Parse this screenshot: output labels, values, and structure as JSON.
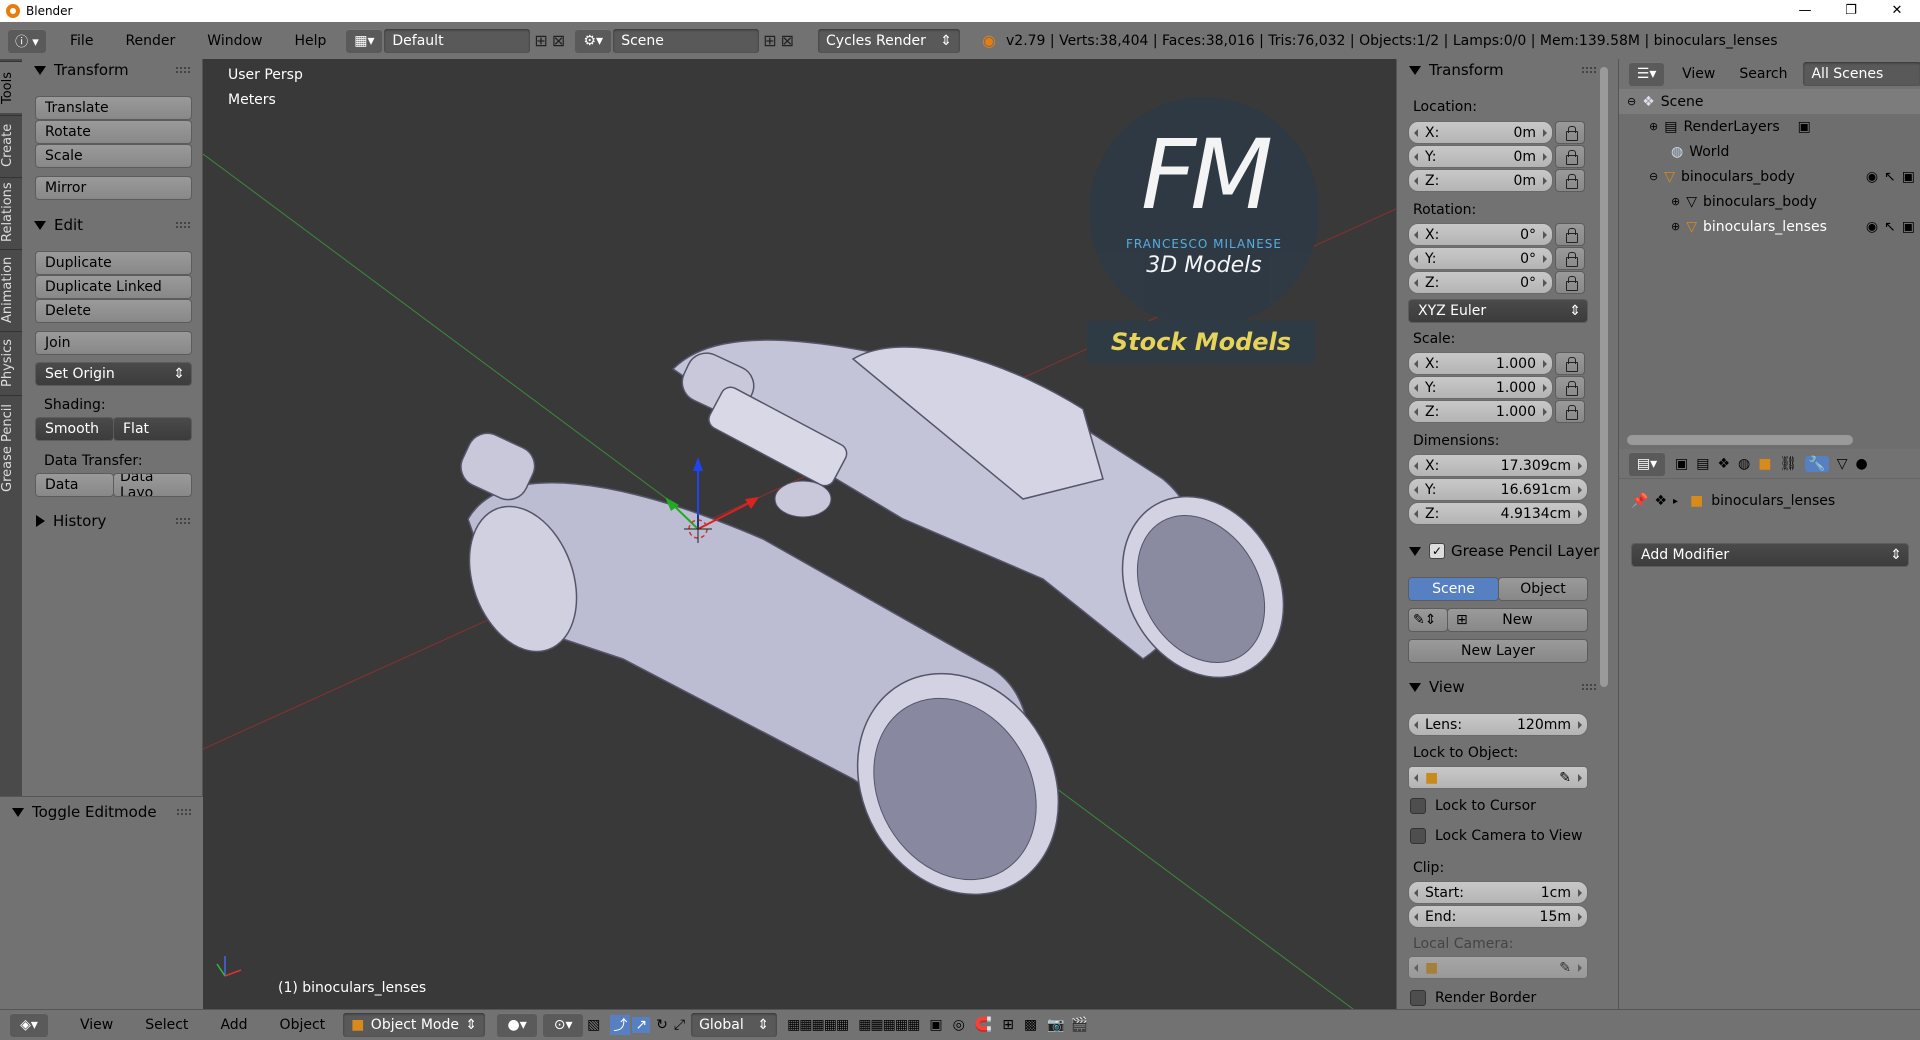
{
  "titlebar": {
    "title": "Blender",
    "min": "—",
    "max": "❐",
    "close": "✕"
  },
  "infobar": {
    "menus": [
      "File",
      "Render",
      "Window",
      "Help"
    ],
    "screen": "Default",
    "scene": "Scene",
    "engine": "Cycles Render",
    "stats": "v2.79 | Verts:38,404 | Faces:38,016 | Tris:76,032 | Objects:1/2 | Lamps:0/0 | Mem:139.58M | binoculars_lenses"
  },
  "tooltabs": [
    "Tools",
    "Create",
    "Relations",
    "Animation",
    "Physics",
    "Grease Pencil"
  ],
  "tools": {
    "transform_title": "Transform",
    "translate": "Translate",
    "rotate": "Rotate",
    "scale": "Scale",
    "mirror": "Mirror",
    "edit_title": "Edit",
    "duplicate": "Duplicate",
    "duplicate_linked": "Duplicate Linked",
    "delete": "Delete",
    "join": "Join",
    "set_origin": "Set Origin",
    "shading_label": "Shading:",
    "smooth": "Smooth",
    "flat": "Flat",
    "data_transfer_label": "Data Transfer:",
    "data": "Data",
    "data_layo": "Data Layo",
    "history_title": "History",
    "toggle_editmode": "Toggle Editmode"
  },
  "viewport": {
    "view_name": "User Persp",
    "units": "Meters",
    "object_label": "(1) binoculars_lenses",
    "watermark_initials": "FM",
    "watermark_name": "FRANCESCO MILANESE",
    "watermark_sub": "3D Models",
    "watermark_banner": "Stock Models",
    "axis_x_color": "#b33030",
    "axis_y_color": "#3a8a3a"
  },
  "npanel": {
    "transform_title": "Transform",
    "location_label": "Location:",
    "location": [
      {
        "k": "X:",
        "v": "0m"
      },
      {
        "k": "Y:",
        "v": "0m"
      },
      {
        "k": "Z:",
        "v": "0m"
      }
    ],
    "rotation_label": "Rotation:",
    "rotation": [
      {
        "k": "X:",
        "v": "0°"
      },
      {
        "k": "Y:",
        "v": "0°"
      },
      {
        "k": "Z:",
        "v": "0°"
      }
    ],
    "rotation_mode": "XYZ Euler",
    "scale_label": "Scale:",
    "scale": [
      {
        "k": "X:",
        "v": "1.000"
      },
      {
        "k": "Y:",
        "v": "1.000"
      },
      {
        "k": "Z:",
        "v": "1.000"
      }
    ],
    "dimensions_label": "Dimensions:",
    "dimensions": [
      {
        "k": "X:",
        "v": "17.309cm"
      },
      {
        "k": "Y:",
        "v": "16.691cm"
      },
      {
        "k": "Z:",
        "v": "4.9134cm"
      }
    ],
    "gp_title": "Grease Pencil Layer",
    "gp_scene": "Scene",
    "gp_object": "Object",
    "gp_new": "New",
    "gp_new_layer": "New Layer",
    "view_title": "View",
    "lens_k": "Lens:",
    "lens_v": "120mm",
    "lock_to_object": "Lock to Object:",
    "lock_to_cursor": "Lock to Cursor",
    "lock_camera": "Lock Camera to View",
    "clip_label": "Clip:",
    "clip_start_k": "Start:",
    "clip_start_v": "1cm",
    "clip_end_k": "End:",
    "clip_end_v": "15m",
    "local_camera": "Local Camera:",
    "render_border": "Render Border"
  },
  "outliner": {
    "view": "View",
    "search": "Search",
    "all_scenes": "All Scenes",
    "items": [
      {
        "label": "Scene"
      },
      {
        "label": "RenderLayers"
      },
      {
        "label": "World"
      },
      {
        "label": "binoculars_body"
      },
      {
        "label": "binoculars_body"
      },
      {
        "label": "binoculars_lenses"
      }
    ]
  },
  "properties": {
    "object_name": "binoculars_lenses",
    "add_modifier": "Add Modifier"
  },
  "bottombar": {
    "view": "View",
    "select": "Select",
    "add": "Add",
    "object": "Object",
    "mode": "Object Mode",
    "orientation": "Global"
  }
}
